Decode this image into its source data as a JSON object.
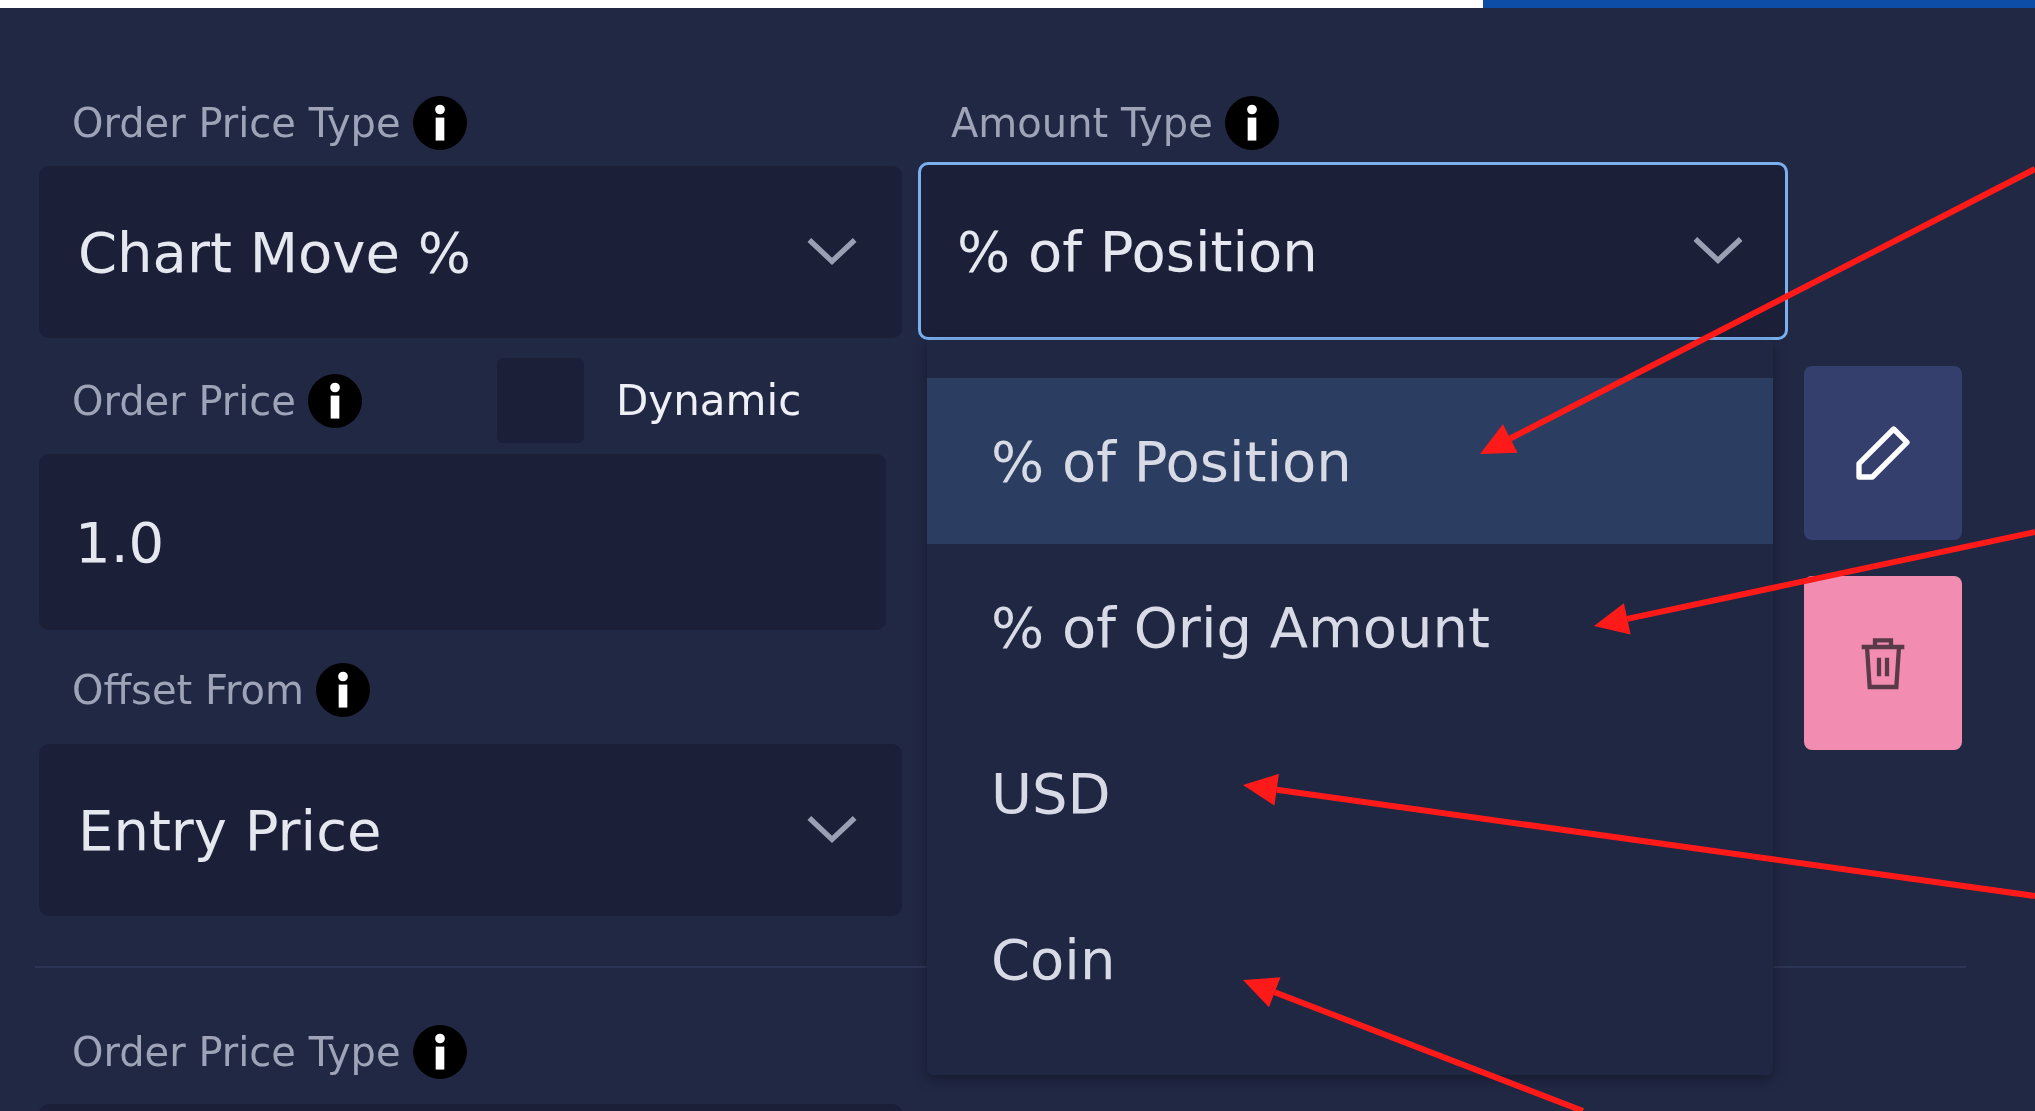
{
  "order_price_type": {
    "label": "Order Price Type",
    "value": "Chart Move %"
  },
  "amount_type": {
    "label": "Amount Type",
    "value": "% of Position",
    "focused": true,
    "expanded": true,
    "options": [
      {
        "label": "% of Position",
        "selected": true
      },
      {
        "label": "% of Orig Amount",
        "selected": false
      },
      {
        "label": "USD",
        "selected": false
      },
      {
        "label": "Coin",
        "selected": false
      }
    ]
  },
  "order_price": {
    "label": "Order Price",
    "value": "1.0",
    "dynamic": {
      "label": "Dynamic",
      "checked": false
    }
  },
  "offset_from": {
    "label": "Offset From",
    "value": "Entry Price"
  },
  "buttons": [
    {
      "kind": "edit"
    },
    {
      "kind": "delete"
    }
  ],
  "next_order": {
    "order_price_type": {
      "label": "Order Price Type"
    }
  }
}
